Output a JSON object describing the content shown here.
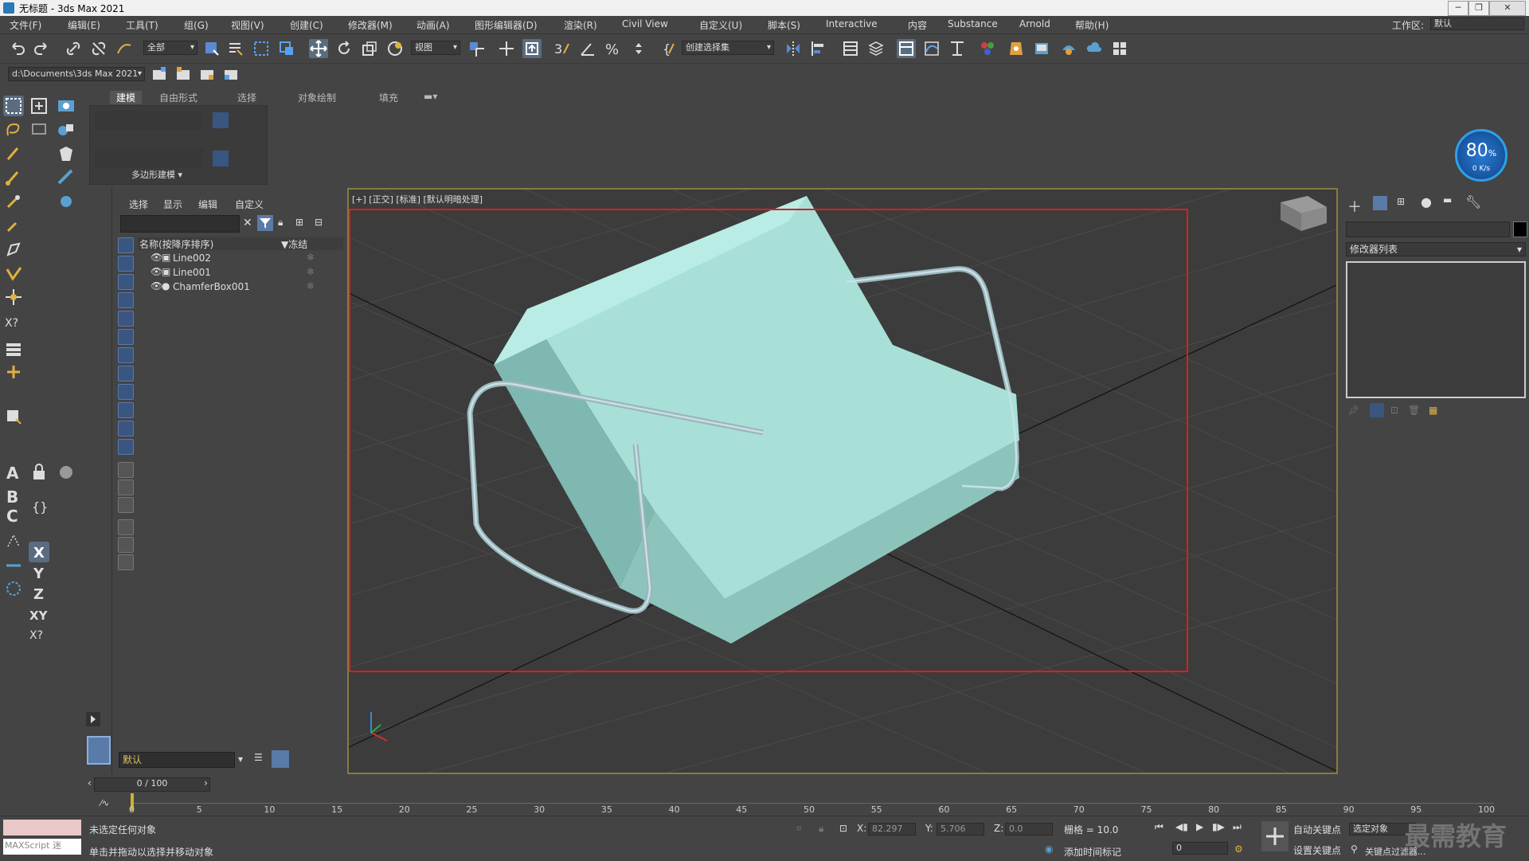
{
  "window": {
    "title": "无标题 - 3ds Max 2021"
  },
  "menubar": {
    "items": [
      "文件(F)",
      "编辑(E)",
      "工具(T)",
      "组(G)",
      "视图(V)",
      "创建(C)",
      "修改器(M)",
      "动画(A)",
      "图形编辑器(D)",
      "渲染(R)",
      "Civil View",
      "自定义(U)",
      "脚本(S)",
      "Interactive",
      "内容",
      "Substance",
      "Arnold",
      "帮助(H)"
    ],
    "workspace_label": "工作区:",
    "workspace_value": "默认"
  },
  "toolbar1": {
    "selection_filter": "全部",
    "ref_coord": "视图",
    "named_selection": "创建选择集"
  },
  "toolbar2": {
    "project_path": "d:\\Documents\\3ds Max 2021"
  },
  "ribbon": {
    "tabs": [
      "建模",
      "自由形式",
      "选择",
      "对象绘制",
      "填充"
    ],
    "panel_label": "多边形建模 ▾"
  },
  "explorer": {
    "tabs": [
      "选择",
      "显示",
      "编辑",
      "自定义"
    ],
    "col_name": "名称(按降序排序)",
    "col_frozen": "▼冻结",
    "rows": [
      "Line002",
      "Line001",
      "ChamferBox001"
    ],
    "layer": "默认"
  },
  "viewport": {
    "label": "[+] [正交] [标准] [默认明暗处理]"
  },
  "perf": {
    "value": "80",
    "unit": "%",
    "rate": "0 K/s"
  },
  "cmdpanel": {
    "modifier_list": "修改器列表"
  },
  "timeline": {
    "frame_counter": "0 / 100",
    "ticks": [
      "0",
      "5",
      "10",
      "15",
      "20",
      "25",
      "30",
      "35",
      "40",
      "45",
      "50",
      "55",
      "60",
      "65",
      "70",
      "75",
      "80",
      "85",
      "90",
      "95",
      "100"
    ]
  },
  "status": {
    "maxscript": "MAXScript 迷",
    "line1": "未选定任何对象",
    "line2": "单击并拖动以选择并移动对象",
    "x_label": "X:",
    "x_value": "82.297",
    "y_label": "Y:",
    "y_value": "5.706",
    "z_label": "Z:",
    "z_value": "0.0",
    "grid": "栅格 = 10.0",
    "add_time_tag": "添加时间标记",
    "auto_key": "自动关键点",
    "selected_obj": "选定对象",
    "set_key": "设置关键点",
    "key_filter": "关键点过滤器...",
    "frame_value": "0"
  },
  "watermark": "最需教育"
}
